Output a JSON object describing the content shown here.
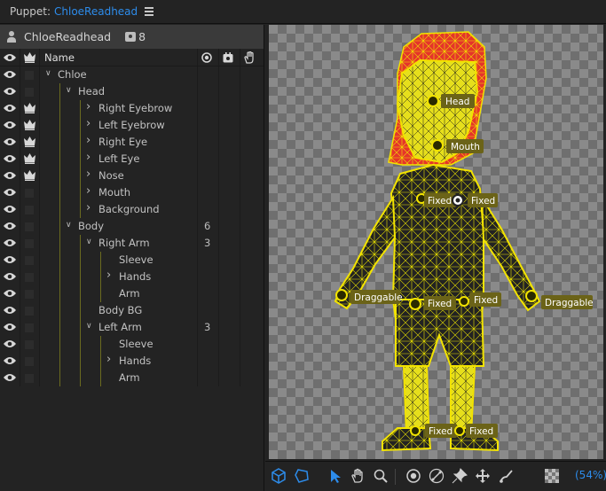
{
  "title_bar": {
    "prefix": "Puppet:",
    "puppet_name": "ChloeReadhead"
  },
  "puppet_header": {
    "name": "ChloeReadhead",
    "count": "8"
  },
  "columns": {
    "name": "Name"
  },
  "tree": [
    {
      "label": "Chloe",
      "count": ""
    },
    {
      "label": "Head",
      "count": ""
    },
    {
      "label": "Right Eyebrow",
      "count": ""
    },
    {
      "label": "Left Eyebrow",
      "count": ""
    },
    {
      "label": "Right Eye",
      "count": ""
    },
    {
      "label": "Left Eye",
      "count": ""
    },
    {
      "label": "Nose",
      "count": ""
    },
    {
      "label": "Mouth",
      "count": ""
    },
    {
      "label": "Background",
      "count": ""
    },
    {
      "label": "Body",
      "count": "6"
    },
    {
      "label": "Right Arm",
      "count": "3"
    },
    {
      "label": "Sleeve",
      "count": ""
    },
    {
      "label": "Hands",
      "count": ""
    },
    {
      "label": "Arm",
      "count": ""
    },
    {
      "label": "Body BG",
      "count": ""
    },
    {
      "label": "Left Arm",
      "count": "3"
    },
    {
      "label": "Sleeve",
      "count": ""
    },
    {
      "label": "Hands",
      "count": ""
    },
    {
      "label": "Arm",
      "count": ""
    }
  ],
  "pins": {
    "head": "Head",
    "mouth": "Mouth",
    "fixed_chest_left": "Fixed",
    "fixed_chest_right": "Fixed",
    "draggable_left": "Draggable",
    "fixed_waist_left": "Fixed",
    "fixed_waist_right": "Fixed",
    "draggable_right": "Draggable",
    "fixed_foot_left": "Fixed",
    "fixed_foot_right": "Fixed"
  },
  "toolbar": {
    "zoom": "(54%)"
  },
  "colors": {
    "accent": "#2d8ceb",
    "mesh": "#e8e000",
    "pin_label_bg": "#6b6318"
  }
}
